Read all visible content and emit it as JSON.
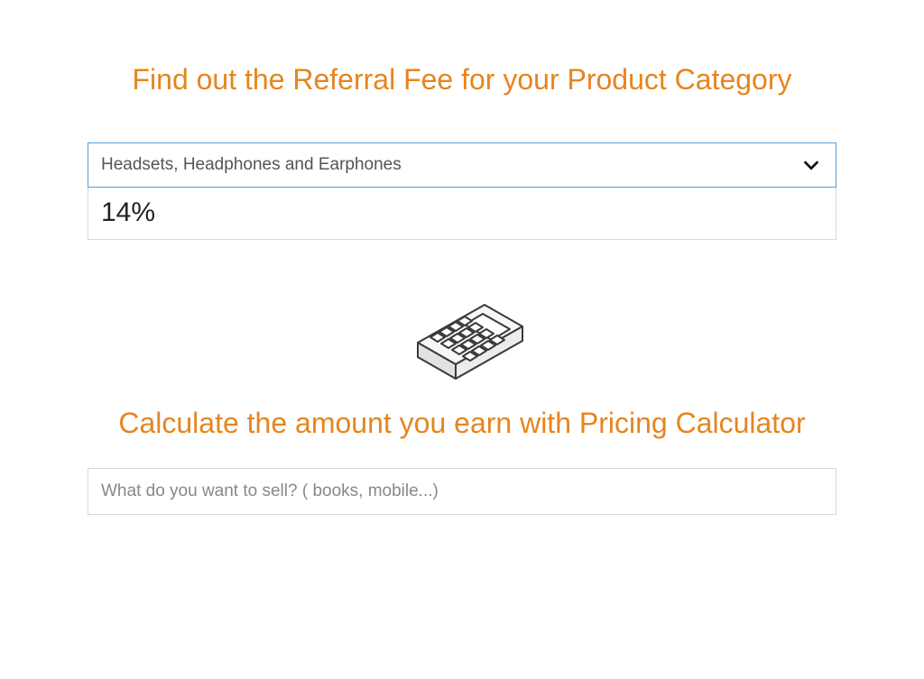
{
  "referral": {
    "heading": "Find out the Referral Fee for your Product Category",
    "select": {
      "value": "Headsets, Headphones and Earphones"
    },
    "fee_percent": "14%"
  },
  "calculator": {
    "heading": "Calculate the amount you earn with Pricing Calculator",
    "search_placeholder": "What do you want to sell? ( books, mobile...)"
  }
}
